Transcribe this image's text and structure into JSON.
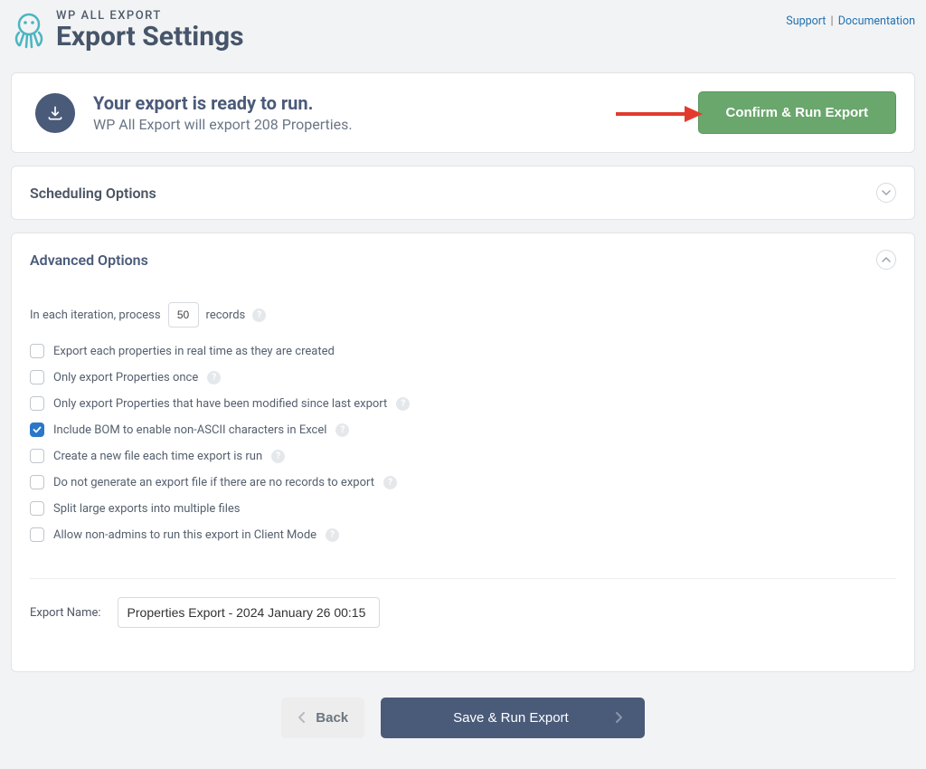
{
  "header": {
    "product": "WP ALL EXPORT",
    "title": "Export Settings",
    "links": {
      "support": "Support",
      "docs": "Documentation"
    }
  },
  "ready": {
    "title": "Your export is ready to run.",
    "subtitle": "WP All Export will export 208 Properties.",
    "confirm": "Confirm & Run Export"
  },
  "scheduling": {
    "title": "Scheduling Options"
  },
  "advanced": {
    "title": "Advanced Options",
    "iter_pre": "In each iteration, process",
    "iter_value": "50",
    "iter_post": "records",
    "options": [
      {
        "label": "Export each properties in real time as they are created",
        "checked": false,
        "help": false
      },
      {
        "label": "Only export Properties once",
        "checked": false,
        "help": true
      },
      {
        "label": "Only export Properties that have been modified since last export",
        "checked": false,
        "help": true
      },
      {
        "label": "Include BOM to enable non-ASCII characters in Excel",
        "checked": true,
        "help": true
      },
      {
        "label": "Create a new file each time export is run",
        "checked": false,
        "help": true
      },
      {
        "label": "Do not generate an export file if there are no records to export",
        "checked": false,
        "help": true
      },
      {
        "label": "Split large exports into multiple files",
        "checked": false,
        "help": false
      },
      {
        "label": "Allow non-admins to run this export in Client Mode",
        "checked": false,
        "help": true
      }
    ],
    "export_name_label": "Export Name:",
    "export_name_value": "Properties Export - 2024 January 26 00:15"
  },
  "footer": {
    "back": "Back",
    "save": "Save & Run Export"
  }
}
